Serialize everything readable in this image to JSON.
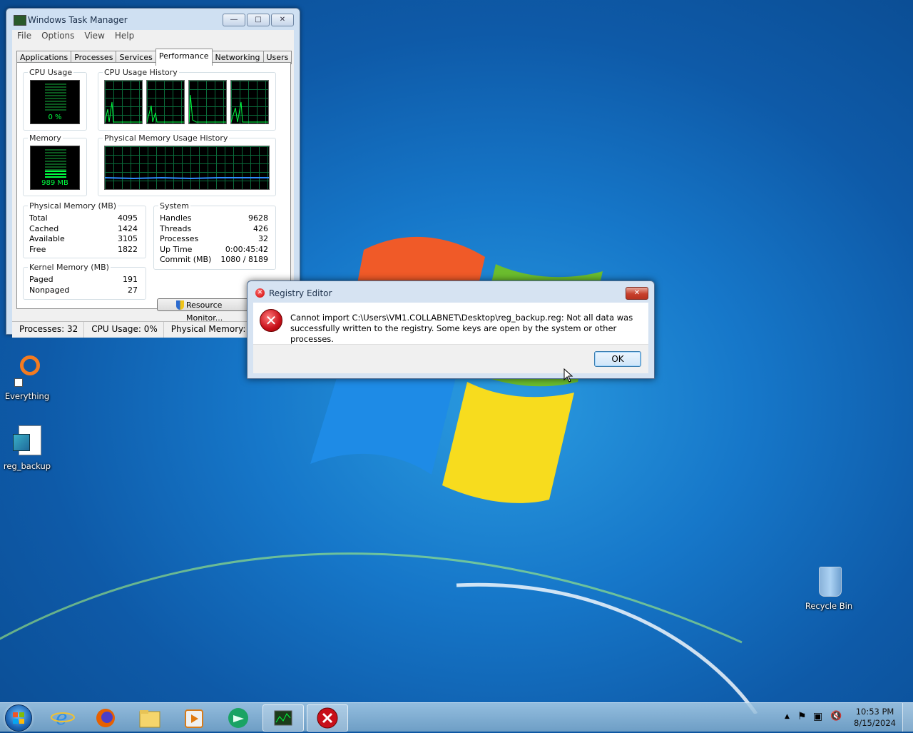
{
  "task_manager": {
    "title": "Windows Task Manager",
    "menu": [
      "File",
      "Options",
      "View",
      "Help"
    ],
    "tabs": [
      "Applications",
      "Processes",
      "Services",
      "Performance",
      "Networking",
      "Users"
    ],
    "active_tab": "Performance",
    "groups": {
      "cpu_usage": "CPU Usage",
      "cpu_history": "CPU Usage History",
      "memory": "Memory",
      "mem_history": "Physical Memory Usage History",
      "physical_memory": "Physical Memory (MB)",
      "system": "System",
      "kernel_memory": "Kernel Memory (MB)"
    },
    "cpu_meter_value": "0 %",
    "memory_meter_value": "989 MB",
    "physical_memory": [
      {
        "label": "Total",
        "value": "4095"
      },
      {
        "label": "Cached",
        "value": "1424"
      },
      {
        "label": "Available",
        "value": "3105"
      },
      {
        "label": "Free",
        "value": "1822"
      }
    ],
    "system": [
      {
        "label": "Handles",
        "value": "9628"
      },
      {
        "label": "Threads",
        "value": "426"
      },
      {
        "label": "Processes",
        "value": "32"
      },
      {
        "label": "Up Time",
        "value": "0:00:45:42"
      },
      {
        "label": "Commit (MB)",
        "value": "1080 / 8189"
      }
    ],
    "kernel_memory": [
      {
        "label": "Paged",
        "value": "191"
      },
      {
        "label": "Nonpaged",
        "value": "27"
      }
    ],
    "resource_monitor_button": "Resource Monitor...",
    "status": {
      "processes": "Processes: 32",
      "cpu": "CPU Usage: 0%",
      "memory": "Physical Memory: 24%"
    }
  },
  "dialog": {
    "title": "Registry Editor",
    "message": "Cannot import C:\\Users\\VM1.COLLABNET\\Desktop\\reg_backup.reg: Not all data was successfully written to the registry.  Some keys are open by the system or other processes.",
    "ok_label": "OK"
  },
  "desktop_icons": {
    "everything": "Everything",
    "reg_backup": "reg_backup",
    "recycle_bin": "Recycle Bin"
  },
  "taskbar": {
    "items": [
      "internet-explorer-icon",
      "firefox-icon",
      "file-explorer-icon",
      "media-player-icon",
      "remote-icon",
      "task-manager-icon",
      "registry-error-icon"
    ],
    "time": "10:53 PM",
    "date": "8/15/2024"
  },
  "colors": {
    "graph_green": "#00ff41",
    "error_red": "#c8101a",
    "desktop_blue": "#1677c9"
  }
}
